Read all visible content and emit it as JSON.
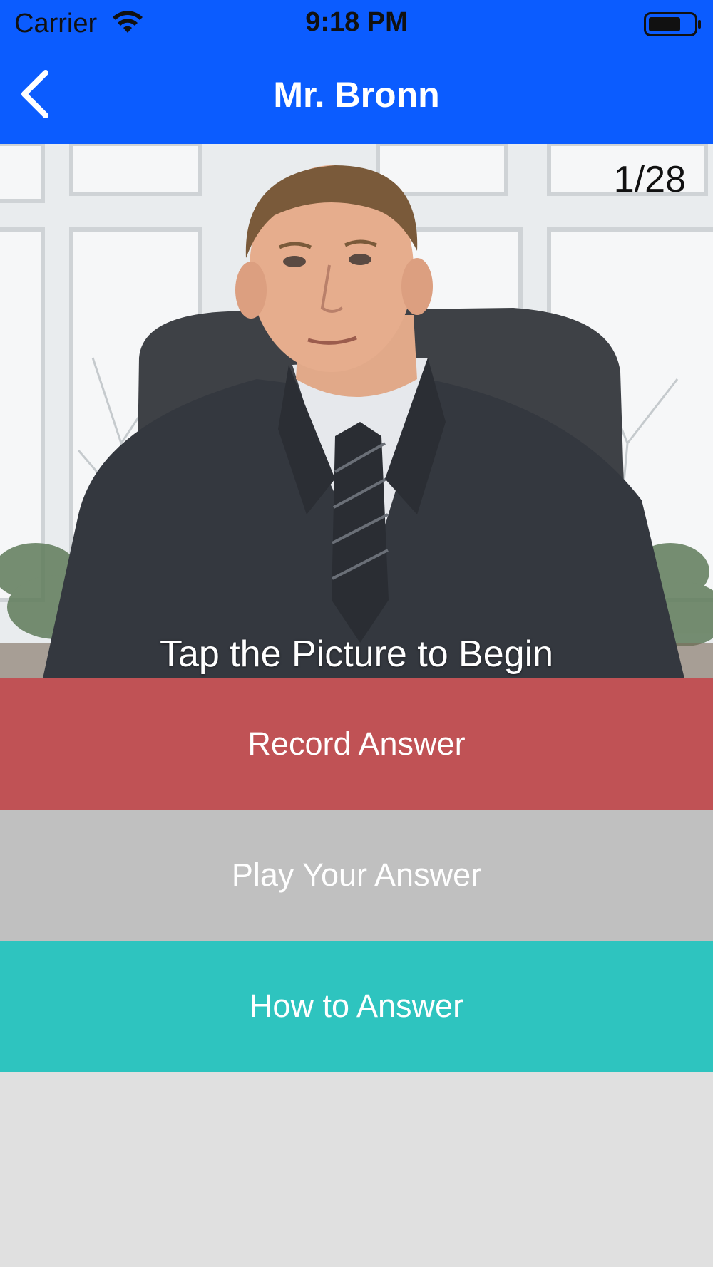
{
  "status_bar": {
    "carrier": "Carrier",
    "time": "9:18 PM",
    "wifi_icon": "wifi-icon",
    "battery_icon": "battery-icon"
  },
  "nav": {
    "title": "Mr. Bronn",
    "back_icon": "chevron-left-icon"
  },
  "picture": {
    "counter": "1/28",
    "caption": "Tap the Picture to Begin"
  },
  "actions": {
    "record": "Record Answer",
    "play": "Play Your Answer",
    "how": "How to Answer"
  },
  "colors": {
    "nav_background": "#0b5cff",
    "record_background": "#c05255",
    "play_background": "#c0c0c0",
    "how_background": "#2ec4bf",
    "page_background": "#e0e0e0"
  }
}
